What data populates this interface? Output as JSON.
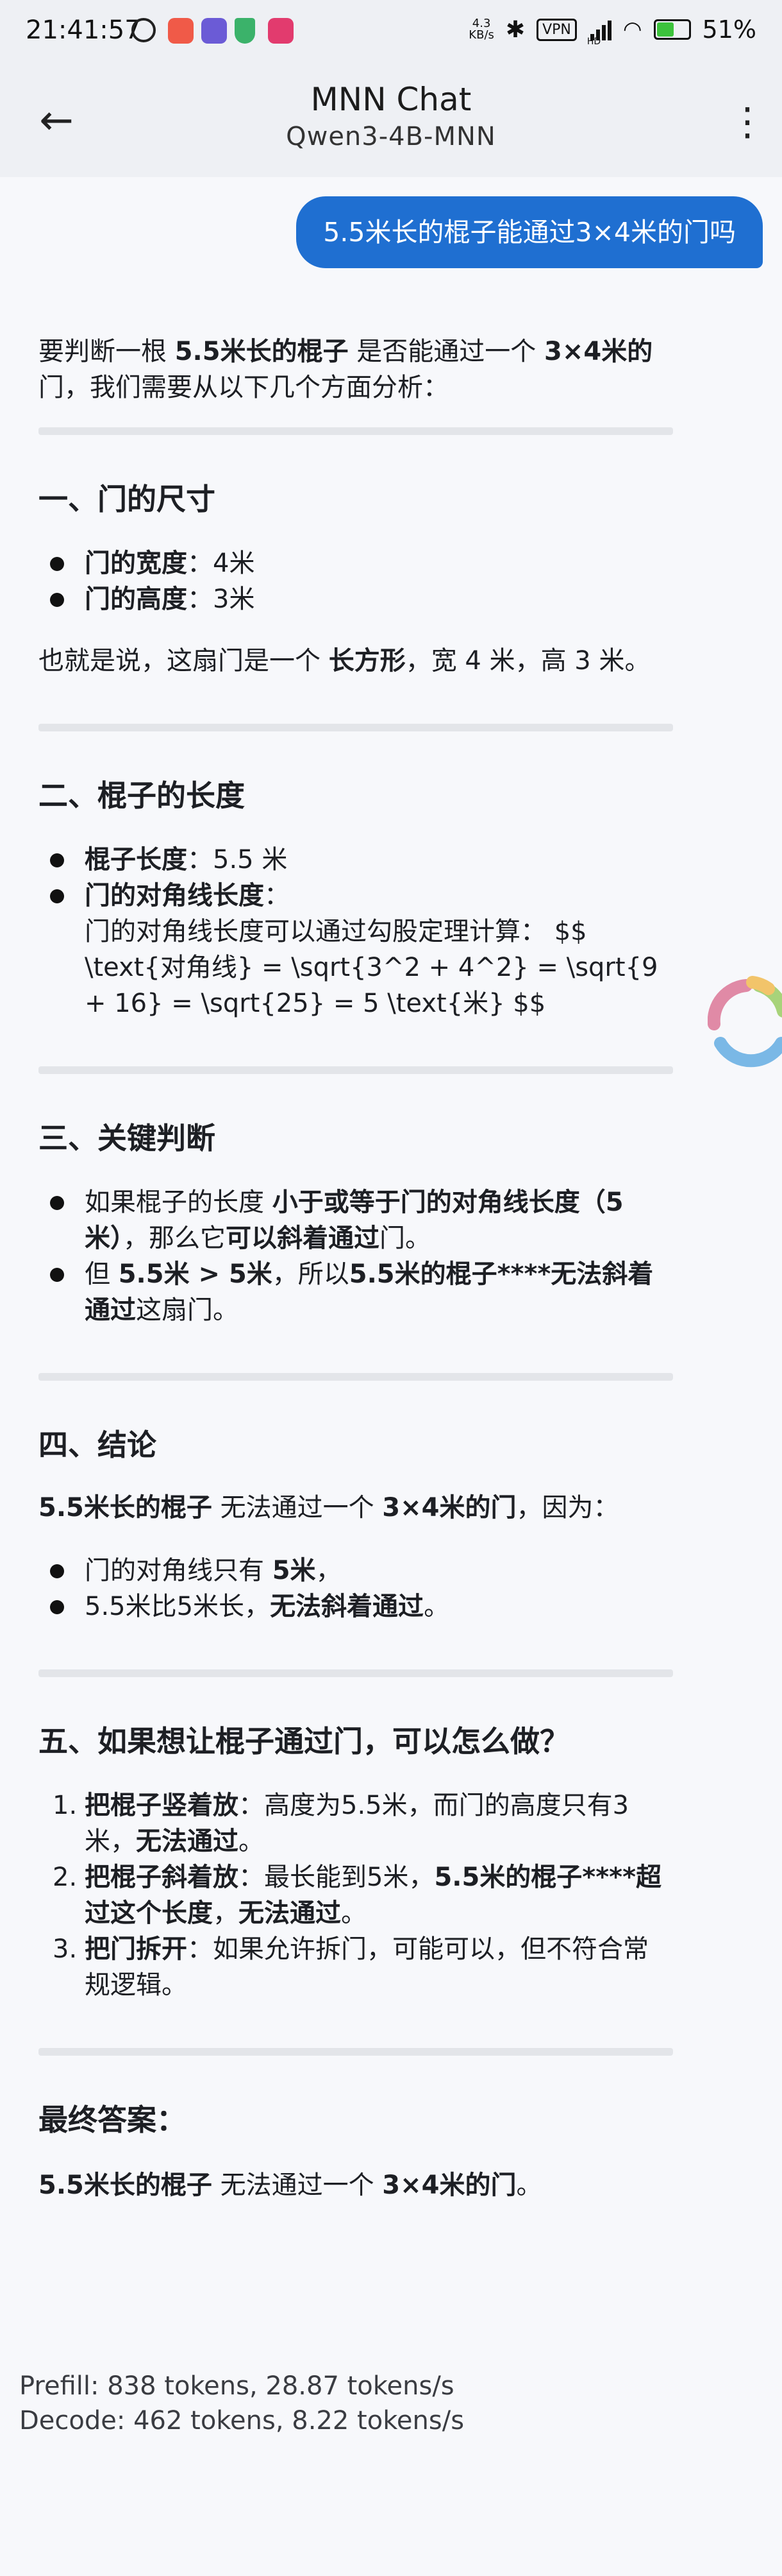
{
  "status_bar": {
    "time": "21:41:57",
    "net_speed_top": "4.3",
    "net_speed_bottom": "KB/s",
    "vpn": "VPN",
    "hd": "HD",
    "battery": "51%"
  },
  "app_bar": {
    "title": "MNN Chat",
    "subtitle": "Qwen3-4B-MNN"
  },
  "user_message": "5.5米长的棍子能通过3×4米的门吗",
  "reply": {
    "intro": [
      "要判断一根 ",
      "5.5米长的棍子",
      " 是否能通过一个 ",
      "3×4米的",
      "门，我们需要从以下几个方面分析："
    ],
    "s1": {
      "title": "一、门的尺寸",
      "items": [
        [
          "门的宽度",
          "：4米"
        ],
        [
          "门的高度",
          "：3米"
        ]
      ],
      "summary": [
        "也就是说，这扇门是一个 ",
        "长方形",
        "，宽 4 米，高 3 米。"
      ]
    },
    "s2": {
      "title": "二、棍子的长度",
      "items": [
        [
          "棍子长度",
          "：5.5 米"
        ],
        [
          "门的对角线长度",
          "："
        ]
      ],
      "detail": "门的对角线长度可以通过勾股定理计算： $$ \\text{对角线} = \\sqrt{3^2 + 4^2} = \\sqrt{9 + 16} = \\sqrt{25} = 5 \\text{米} $$"
    },
    "s3": {
      "title": "三、关键判断",
      "i1": [
        "如果棍子的长度 ",
        "小于或等于门的对角线长度（5米）",
        "，那么它",
        "可以斜着通过",
        "门。"
      ],
      "i2": [
        "但 ",
        "5.5米 > 5米",
        "，所以",
        "5.5米的棍子****无法斜着通过",
        "这扇门。"
      ]
    },
    "s4": {
      "title": "四、结论",
      "lead": [
        "5.5米长的棍子",
        " 无法通过一个 ",
        "3×4米的门",
        "，因为："
      ],
      "i1": [
        "门的对角线只有 ",
        "5米",
        "，"
      ],
      "i2": [
        "5.5米比5米长，",
        "无法斜着通过",
        "。"
      ]
    },
    "s5": {
      "title": "五、如果想让棍子通过门，可以怎么做？",
      "items": [
        [
          "1.",
          "把棍子竖着放",
          "：高度为5.5米，而门的高度只有3米，",
          "无法通过",
          "。"
        ],
        [
          "2.",
          "把棍子斜着放",
          "：最长能到5米，",
          "5.5米的棍子****超过这个长度",
          "，",
          "无法通过",
          "。"
        ],
        [
          "3.",
          "把门拆开",
          "：如果允许拆门，可能可以，但不符合常规逻辑。"
        ]
      ]
    },
    "final": {
      "title": "最终答案：",
      "text": [
        "5.5米长的棍子",
        " 无法通过一个 ",
        "3×4米的门",
        "。"
      ]
    }
  },
  "stats": {
    "prefill": "Prefill: 838 tokens, 28.87 tokens/s",
    "decode": "Decode: 462 tokens, 8.22 tokens/s"
  },
  "colors": {
    "bubble": "#1f6fd1",
    "background": "#f7f8fb",
    "bar": "#eef0f4"
  }
}
